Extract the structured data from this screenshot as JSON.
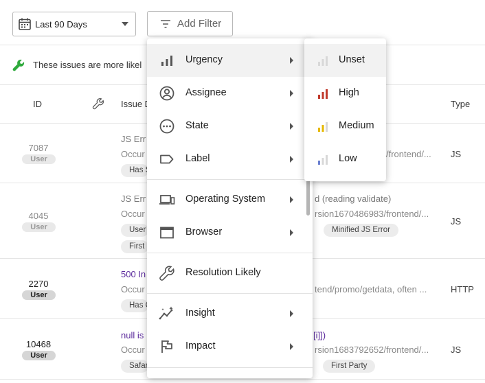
{
  "toolbar": {
    "date_range": "Last 90 Days",
    "add_filter": "Add Filter"
  },
  "banner": {
    "text": "These issues are more likel"
  },
  "table": {
    "headers": {
      "id": "ID",
      "issue": "Issue D",
      "type": "Type"
    },
    "rows": [
      {
        "id": "7087",
        "badge": "User",
        "title": "JS Err",
        "title_right": "",
        "occ": "Occur",
        "occ_right": "/frontend/...",
        "chips": [
          "Has S"
        ],
        "type": "JS"
      },
      {
        "id": "4045",
        "badge": "User",
        "title": "JS Err",
        "title_right": "d (reading validate)",
        "occ": "Occur",
        "occ_right": "rsion1670486983/frontend/...",
        "chips": [
          "User",
          "First",
          "Minified JS Error"
        ],
        "type": "JS"
      },
      {
        "id": "2270",
        "badge": "User",
        "title": "500 In",
        "title_right": "",
        "occ": "Occur",
        "occ_right": "tend/promo/getdata, often ...",
        "chips": [
          "Has C"
        ],
        "type": "HTTP"
      },
      {
        "id": "10468",
        "badge": "User",
        "title": "null is",
        "title_right": "[i]])",
        "occ": "Occur",
        "occ_right": "rsion1683792652/frontend/...",
        "chips": [
          "Safar",
          "First Party"
        ],
        "type": "JS"
      }
    ]
  },
  "filter_menu": {
    "items": [
      {
        "label": "Urgency",
        "icon": "bar-chart-icon",
        "submenu": true
      },
      {
        "label": "Assignee",
        "icon": "person-circle-icon",
        "submenu": true
      },
      {
        "label": "State",
        "icon": "dots-circle-icon",
        "submenu": true
      },
      {
        "label": "Label",
        "icon": "tag-icon",
        "submenu": true
      },
      {
        "label": "Operating System",
        "icon": "devices-icon",
        "submenu": true
      },
      {
        "label": "Browser",
        "icon": "browser-window-icon",
        "submenu": true
      },
      {
        "label": "Resolution Likely",
        "icon": "wrench-icon",
        "submenu": false
      },
      {
        "label": "Insight",
        "icon": "sparkle-chart-icon",
        "submenu": true
      },
      {
        "label": "Impact",
        "icon": "flag-icon",
        "submenu": true
      }
    ]
  },
  "urgency_menu": {
    "items": [
      {
        "label": "Unset",
        "color": "#d0d0d0",
        "level": 0
      },
      {
        "label": "High",
        "color": "#c0392b",
        "level": 3
      },
      {
        "label": "Medium",
        "color": "#e6b800",
        "level": 2
      },
      {
        "label": "Low",
        "color": "#6a7fd0",
        "level": 1
      }
    ]
  },
  "colors": {
    "accent_green": "#2eaa3c",
    "link_purple": "#5b2a9c"
  }
}
